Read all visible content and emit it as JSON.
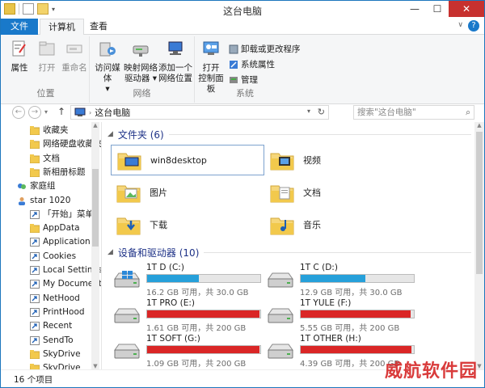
{
  "window": {
    "title": "这台电脑"
  },
  "ribbon_tabs": {
    "file": "文件",
    "computer": "计算机",
    "view": "查看",
    "help": "?"
  },
  "ribbon": {
    "location_group": {
      "label": "位置",
      "properties": "属性",
      "open": "打开",
      "rename": "重命名"
    },
    "network_group": {
      "label": "网络",
      "access_media": [
        "访问媒体",
        "▾"
      ],
      "map_drive": [
        "映射网络",
        "驱动器 ▾"
      ],
      "add_location": [
        "添加一个",
        "网络位置"
      ]
    },
    "system_group": {
      "label": "系统",
      "control_panel": [
        "打开",
        "控制面板"
      ],
      "uninstall": "卸载或更改程序",
      "system_properties": "系统属性",
      "manage": "管理"
    }
  },
  "address": {
    "path": "这台电脑",
    "search_placeholder": "搜索\"这台电脑\""
  },
  "nav_pane": {
    "items": [
      {
        "label": "收藏夹",
        "icon": "folder-icon"
      },
      {
        "label": "网络硬盘收藏夹",
        "icon": "folder-icon"
      },
      {
        "label": "文档",
        "icon": "folder-icon"
      },
      {
        "label": "新相册标题",
        "icon": "folder-icon"
      },
      {
        "label": "家庭组",
        "icon": "homegroup-icon"
      },
      {
        "label": "star 1020",
        "icon": "user-icon"
      },
      {
        "label": "「开始」菜单",
        "icon": "shortcut-icon"
      },
      {
        "label": "AppData",
        "icon": "folder-icon"
      },
      {
        "label": "Application D",
        "icon": "shortcut-icon"
      },
      {
        "label": "Cookies",
        "icon": "shortcut-icon"
      },
      {
        "label": "Local Settings",
        "icon": "shortcut-icon"
      },
      {
        "label": "My Document",
        "icon": "shortcut-icon"
      },
      {
        "label": "NetHood",
        "icon": "shortcut-icon"
      },
      {
        "label": "PrintHood",
        "icon": "shortcut-icon"
      },
      {
        "label": "Recent",
        "icon": "shortcut-icon"
      },
      {
        "label": "SendTo",
        "icon": "shortcut-icon"
      },
      {
        "label": "SkyDrive",
        "icon": "folder-icon"
      },
      {
        "label": "SkyDrive",
        "icon": "folder-icon"
      }
    ]
  },
  "folders_section": {
    "header": "文件夹 (6)",
    "items": [
      {
        "name": "win8desktop",
        "icon": "desktop-folder-icon",
        "selected": true
      },
      {
        "name": "视频",
        "icon": "videos-folder-icon"
      },
      {
        "name": "图片",
        "icon": "pictures-folder-icon"
      },
      {
        "name": "文档",
        "icon": "documents-folder-icon"
      },
      {
        "name": "下载",
        "icon": "downloads-folder-icon"
      },
      {
        "name": "音乐",
        "icon": "music-folder-icon"
      }
    ]
  },
  "drives_section": {
    "header": "设备和驱动器 (10)",
    "items": [
      {
        "name": "1T D (C:)",
        "free": "16.2 GB 可用，共 30.0 GB",
        "used_fraction": 0.46,
        "color": "#26a0da",
        "icon": "windows-drive-icon"
      },
      {
        "name": "1T C (D:)",
        "free": "12.9 GB 可用，共 30.0 GB",
        "used_fraction": 0.57,
        "color": "#26a0da",
        "icon": "drive-icon"
      },
      {
        "name": "1T PRO (E:)",
        "free": "1.61 GB 可用，共 200 GB",
        "used_fraction": 0.99,
        "color": "#da2626",
        "icon": "drive-icon"
      },
      {
        "name": "1T YULE (F:)",
        "free": "5.55 GB 可用，共 200 GB",
        "used_fraction": 0.97,
        "color": "#da2626",
        "icon": "drive-icon"
      },
      {
        "name": "1T SOFT (G:)",
        "free": "1.09 GB 可用，共 200 GB",
        "used_fraction": 0.99,
        "color": "#da2626",
        "icon": "drive-icon"
      },
      {
        "name": "1T OTHER (H:)",
        "free": "4.39 GB 可用，共 200 GB",
        "used_fraction": 0.98,
        "color": "#da2626",
        "icon": "drive-icon"
      }
    ]
  },
  "status": {
    "count": "16 个项目"
  },
  "watermark": "威航软件园"
}
